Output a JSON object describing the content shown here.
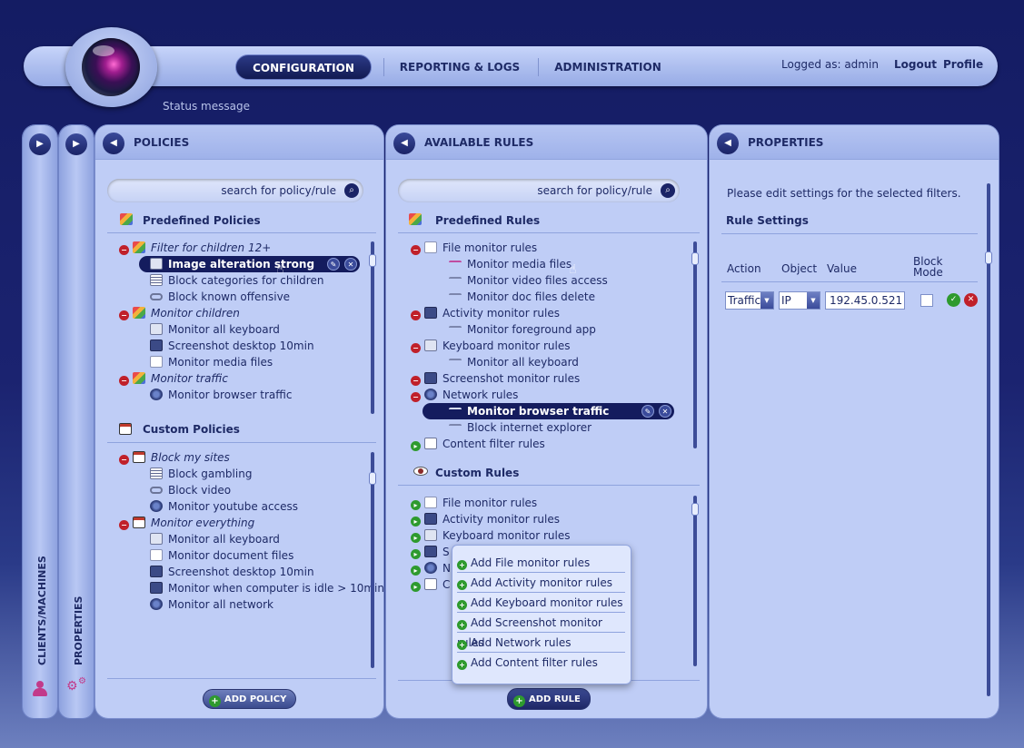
{
  "header": {
    "tabs": [
      {
        "label": "CONFIGURATION",
        "active": true
      },
      {
        "label": "REPORTING & LOGS",
        "active": false
      },
      {
        "label": "ADMINISTRATION",
        "active": false
      }
    ],
    "logged_as": "Logged as: admin",
    "logout": "Logout",
    "profile": "Profile",
    "status": "Status message"
  },
  "side_strips": {
    "clients": "CLIENTS/MACHINES",
    "properties": "PROPERTIES"
  },
  "policies": {
    "title": "POLICIES",
    "search_placeholder": "search for policy/rule",
    "predefined_title": "Predefined Policies",
    "predefined": [
      {
        "label": "Filter for children 12+",
        "type": "group",
        "icon": "group-icon"
      },
      {
        "label": "Image alteration strong",
        "type": "child",
        "icon": "image-edit-icon",
        "selected": true
      },
      {
        "label": "Block categories for children",
        "type": "child",
        "icon": "list-icon"
      },
      {
        "label": "Block known offensive",
        "type": "child",
        "icon": "link-icon"
      },
      {
        "label": "Monitor children",
        "type": "group",
        "icon": "group-icon"
      },
      {
        "label": "Monitor all keyboard",
        "type": "child",
        "icon": "keyboard-icon"
      },
      {
        "label": "Screenshot desktop 10min",
        "type": "child",
        "icon": "monitor-icon"
      },
      {
        "label": "Monitor media files",
        "type": "child",
        "icon": "document-icon"
      },
      {
        "label": "Monitor traffic",
        "type": "group",
        "icon": "group-icon"
      },
      {
        "label": "Monitor browser traffic",
        "type": "child",
        "icon": "network-icon"
      }
    ],
    "custom_title": "Custom Policies",
    "custom": [
      {
        "label": "Block my sites",
        "type": "group",
        "icon": "custom-group-icon"
      },
      {
        "label": "Block gambling",
        "type": "child",
        "icon": "list-icon"
      },
      {
        "label": "Block video",
        "type": "child",
        "icon": "link-icon"
      },
      {
        "label": "Monitor youtube access",
        "type": "child",
        "icon": "network-icon"
      },
      {
        "label": "Monitor everything",
        "type": "group",
        "icon": "custom-group-icon"
      },
      {
        "label": "Monitor all keyboard",
        "type": "child",
        "icon": "keyboard-icon"
      },
      {
        "label": "Monitor document files",
        "type": "child",
        "icon": "document-icon"
      },
      {
        "label": "Screenshot desktop 10min",
        "type": "child",
        "icon": "monitor-icon"
      },
      {
        "label": "Monitor when computer is idle > 10min",
        "type": "child",
        "icon": "activity-icon"
      },
      {
        "label": "Monitor all network",
        "type": "child",
        "icon": "network-icon"
      }
    ],
    "add_button": "ADD POLICY"
  },
  "rules": {
    "title": "AVAILABLE RULES",
    "search_placeholder": "search for policy/rule",
    "predefined_title": "Predefined Rules",
    "predefined": [
      {
        "label": "File monitor rules",
        "type": "group",
        "state": "expanded",
        "icon": "document-icon"
      },
      {
        "label": "Monitor media files",
        "type": "child",
        "icon": "filter-pink-icon"
      },
      {
        "label": "Monitor video files access",
        "type": "child",
        "icon": "filter-icon"
      },
      {
        "label": "Monitor doc files delete",
        "type": "child",
        "icon": "filter-icon"
      },
      {
        "label": "Activity monitor rules",
        "type": "group",
        "state": "expanded",
        "icon": "activity-icon"
      },
      {
        "label": "Monitor foreground app",
        "type": "child",
        "icon": "filter-icon"
      },
      {
        "label": "Keyboard monitor rules",
        "type": "group",
        "state": "expanded",
        "icon": "keyboard-icon"
      },
      {
        "label": "Monitor all keyboard",
        "type": "child",
        "icon": "filter-icon"
      },
      {
        "label": "Screenshot monitor rules",
        "type": "group",
        "state": "expanded",
        "icon": "monitor-icon"
      },
      {
        "label": "Network rules",
        "type": "group",
        "state": "expanded",
        "icon": "network-icon"
      },
      {
        "label": "Monitor browser traffic",
        "type": "child",
        "icon": "filter-icon",
        "selected": true
      },
      {
        "label": "Block internet explorer",
        "type": "child",
        "icon": "filter-icon"
      },
      {
        "label": "Content filter rules",
        "type": "group",
        "state": "collapsed",
        "icon": "content-icon"
      }
    ],
    "custom_title": "Custom Rules",
    "custom": [
      {
        "label": "File monitor rules",
        "icon": "document-icon"
      },
      {
        "label": "Activity monitor rules",
        "icon": "activity-icon"
      },
      {
        "label": "Keyboard monitor rules",
        "icon": "keyboard-icon"
      },
      {
        "label": "S",
        "icon": "monitor-icon"
      },
      {
        "label": "N",
        "icon": "network-icon"
      },
      {
        "label": "C",
        "icon": "content-icon"
      }
    ],
    "popup": [
      "Add File monitor rules",
      "Add Activity monitor rules",
      "Add Keyboard monitor rules",
      "Add Screenshot monitor rules",
      "Add Network rules",
      "Add Content filter rules"
    ],
    "add_button": "ADD RULE"
  },
  "properties": {
    "title": "PROPERTIES",
    "hint": "Please edit settings for the selected filters.",
    "section": "Rule Settings",
    "columns": {
      "action": "Action",
      "object": "Object",
      "value": "Value",
      "block_mode": "Block Mode"
    },
    "row": {
      "action": "Traffic",
      "object": "IP",
      "value": "192.45.0.521",
      "block_mode": false
    }
  },
  "colors": {
    "accent": "#141c5e",
    "panel": "#bfcdf6",
    "ok": "#2e9a2e",
    "cancel": "#c0202a"
  }
}
